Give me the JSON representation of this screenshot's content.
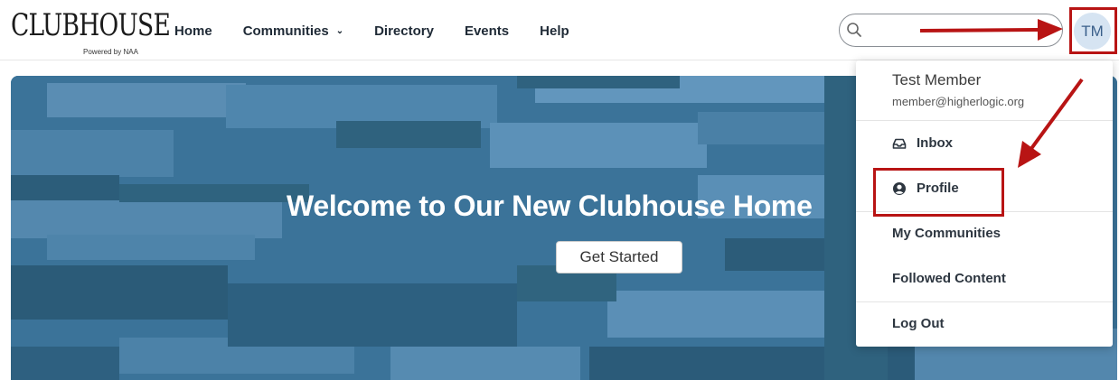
{
  "app": {
    "logo_text": "CLUBHOUSE",
    "logo_subtitle": "Powered by NAA"
  },
  "nav": {
    "items": [
      {
        "label": "Home",
        "has_dropdown": false
      },
      {
        "label": "Communities",
        "has_dropdown": true
      },
      {
        "label": "Directory",
        "has_dropdown": false
      },
      {
        "label": "Events",
        "has_dropdown": false
      },
      {
        "label": "Help",
        "has_dropdown": false
      }
    ]
  },
  "search": {
    "placeholder": "",
    "value": "",
    "icon": "search-icon"
  },
  "user": {
    "initials": "TM",
    "name": "Test Member",
    "email": "member@higherlogic.org"
  },
  "hero": {
    "title": "Welcome to Our New Clubhouse Home",
    "button_label": "Get Started"
  },
  "menu": {
    "inbox_label": "Inbox",
    "inbox_icon": "inbox-icon",
    "profile_label": "Profile",
    "profile_icon": "user-circle-icon",
    "my_communities_label": "My Communities",
    "followed_content_label": "Followed Content",
    "logout_label": "Log Out"
  },
  "colors": {
    "accent_annotation": "#b81414",
    "hero_blue": "#3a7398",
    "avatar_bg": "#d6e4f2"
  }
}
